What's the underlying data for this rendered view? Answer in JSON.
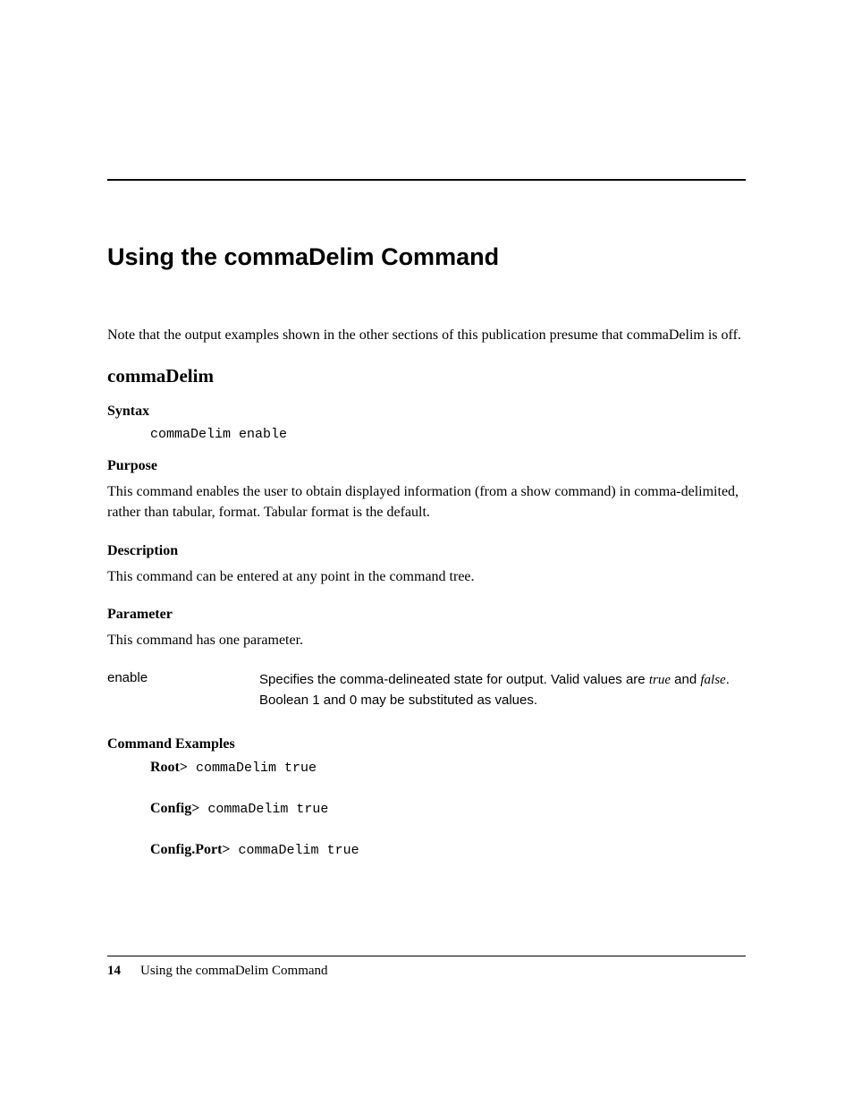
{
  "title": "Using the commaDelim Command",
  "intro": "Note that the output examples shown in the other sections of this publication presume that commaDelim is off.",
  "section_heading": "commaDelim",
  "syntax": {
    "heading": "Syntax",
    "code": "commaDelim enable"
  },
  "purpose": {
    "heading": "Purpose",
    "text": "This command enables the user to obtain displayed information (from a show command) in comma-delimited, rather than tabular, format. Tabular format is the default."
  },
  "description": {
    "heading": "Description",
    "text": "This command can be entered at any point in the command tree."
  },
  "parameter": {
    "heading": "Parameter",
    "intro": "This command has one parameter.",
    "name": "enable",
    "desc_part1": "Specifies the comma-delineated state for output. Valid values are ",
    "true_word": "true",
    "desc_part2": " and ",
    "false_word": "false",
    "desc_part3": ". Boolean 1 and 0 may be substituted as values."
  },
  "examples": {
    "heading": "Command Examples",
    "lines": [
      {
        "prompt": "Root>",
        "cmd": " commaDelim true"
      },
      {
        "prompt": "Config>",
        "cmd": " commaDelim true"
      },
      {
        "prompt": "Config.Port>",
        "cmd": " commaDelim true"
      }
    ]
  },
  "footer": {
    "page_number": "14",
    "chapter": "Using the commaDelim Command"
  }
}
